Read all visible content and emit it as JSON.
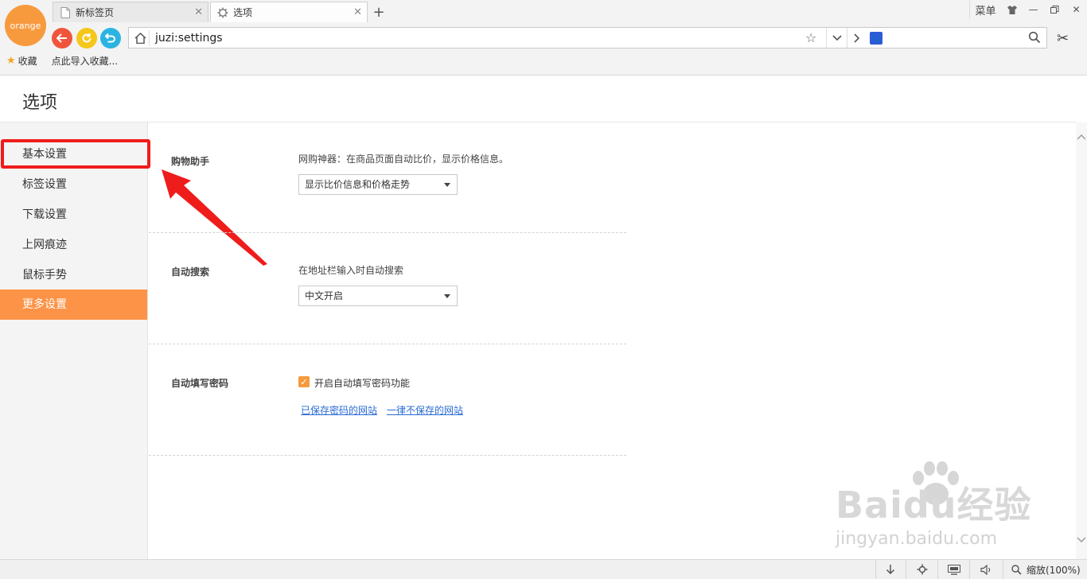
{
  "browser": {
    "logo_text": "orange",
    "tabs": [
      {
        "label": "新标签页",
        "active": false
      },
      {
        "label": "选项",
        "active": true
      }
    ],
    "menu_label": "菜单",
    "url": "juzi:settings",
    "bookmarks": {
      "favorites_label": "收藏",
      "import_label": "点此导入收藏..."
    }
  },
  "page": {
    "title": "选项"
  },
  "sidebar": {
    "items": [
      {
        "label": "基本设置"
      },
      {
        "label": "标签设置"
      },
      {
        "label": "下载设置"
      },
      {
        "label": "上网痕迹"
      },
      {
        "label": "鼠标手势"
      },
      {
        "label": "更多设置"
      }
    ],
    "active_index": 5
  },
  "sections": {
    "shopping": {
      "label": "购物助手",
      "description": "网购神器：在商品页面自动比价，显示价格信息。",
      "select_value": "显示比价信息和价格走势"
    },
    "auto_search": {
      "label": "自动搜索",
      "description": "在地址栏输入时自动搜索",
      "select_value": "中文开启"
    },
    "autofill": {
      "label": "自动填写密码",
      "checkbox_label": "开启自动填写密码功能",
      "checked": true,
      "saved_sites_link": "已保存密码的网站",
      "never_save_link": "一律不保存的网站"
    }
  },
  "statusbar": {
    "zoom_label": "缩放(100%)"
  },
  "watermark": {
    "main": "Baidu经验",
    "sub": "jingyan.baidu.com"
  },
  "colors": {
    "accent": "#fc9347",
    "highlight": "#ef1c1c",
    "link": "#2a6bd6"
  }
}
